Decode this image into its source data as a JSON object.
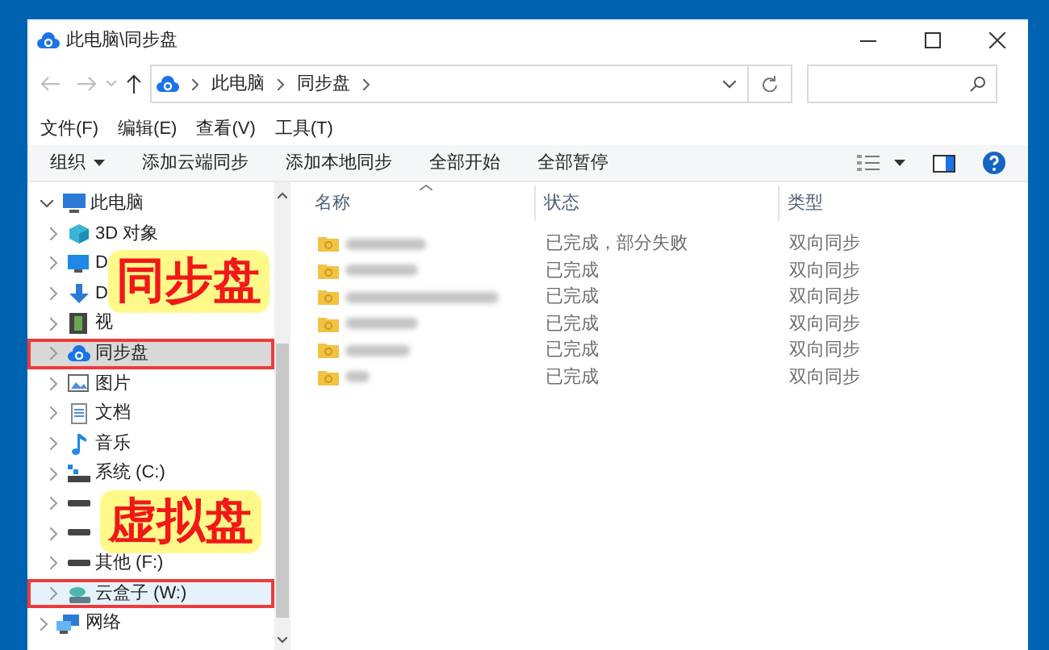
{
  "window": {
    "title": "此电脑\\同步盘"
  },
  "address": {
    "crumbs": [
      "此电脑",
      "同步盘"
    ]
  },
  "menu": [
    "文件(F)",
    "编辑(E)",
    "查看(V)",
    "工具(T)"
  ],
  "toolbar": [
    "组织",
    "添加云端同步",
    "添加本地同步",
    "全部开始",
    "全部暂停"
  ],
  "sidebar": {
    "items": [
      {
        "label": "此电脑",
        "kind": "computer",
        "expanded": true,
        "selected": false,
        "highlighted": false,
        "children": [
          {
            "label": "3D 对象",
            "kind": "cube",
            "expanded": false,
            "selected": false,
            "highlighted": false
          },
          {
            "label": "D",
            "kind": "desktop",
            "expanded": false,
            "selected": false,
            "highlighted": false
          },
          {
            "label": "D",
            "kind": "download",
            "expanded": false,
            "selected": false,
            "highlighted": false
          },
          {
            "label": "视",
            "kind": "video",
            "expanded": false,
            "selected": false,
            "highlighted": false
          },
          {
            "label": "同步盘",
            "kind": "cloud",
            "expanded": false,
            "selected": true,
            "highlighted": true
          },
          {
            "label": "图片",
            "kind": "pictures",
            "expanded": false,
            "selected": false,
            "highlighted": false
          },
          {
            "label": "文档",
            "kind": "documents",
            "expanded": false,
            "selected": false,
            "highlighted": false
          },
          {
            "label": "音乐",
            "kind": "music",
            "expanded": false,
            "selected": false,
            "highlighted": false
          },
          {
            "label": "系统 (C:)",
            "kind": "system-drive",
            "expanded": false,
            "selected": false,
            "highlighted": false
          },
          {
            "kind": "drive",
            "expanded": false,
            "selected": false,
            "highlighted": false
          },
          {
            "kind": "drive",
            "expanded": false,
            "selected": false,
            "highlighted": false
          },
          {
            "label": "其他 (F:)",
            "kind": "drive",
            "expanded": false,
            "selected": false,
            "highlighted": false
          },
          {
            "label": "云盒子 (W:)",
            "kind": "cloud-drive",
            "expanded": false,
            "selected": false,
            "highlighted": true,
            "hovered": true
          }
        ]
      },
      {
        "label": "网络",
        "kind": "network",
        "expanded": false,
        "selected": false,
        "highlighted": false
      }
    ]
  },
  "callouts": [
    {
      "text": "同步盘"
    },
    {
      "text": "虚拟盘"
    }
  ],
  "table": {
    "columns": [
      "名称",
      "状态",
      "类型"
    ],
    "rows": [
      {
        "status": "已完成，部分失败",
        "type": "双向同步"
      },
      {
        "status": "已完成",
        "type": "双向同步"
      },
      {
        "status": "已完成",
        "type": "双向同步"
      },
      {
        "status": "已完成",
        "type": "双向同步"
      },
      {
        "status": "已完成",
        "type": "双向同步"
      },
      {
        "status": "已完成",
        "type": "双向同步"
      }
    ]
  }
}
